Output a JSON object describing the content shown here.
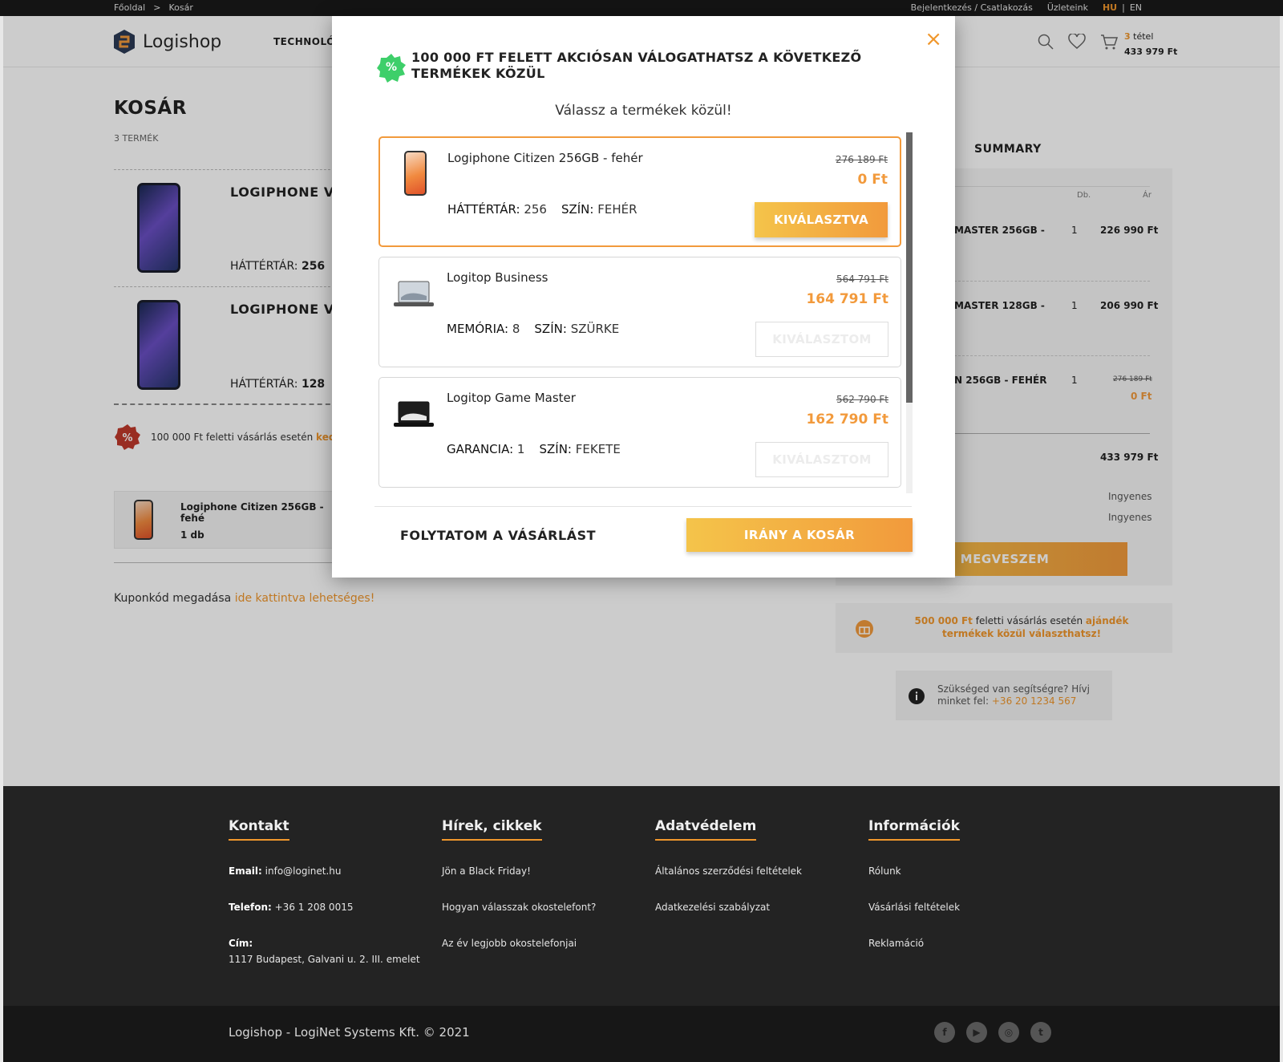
{
  "topbar": {
    "breadcrumb_home": "Főoldal",
    "breadcrumb_sep": ">",
    "breadcrumb_current": "Kosár",
    "login": "Bejelentkezés / Csatlakozás",
    "stores": "Üzleteink",
    "lang_hu": "HU",
    "lang_sep": "|",
    "lang_en": "EN"
  },
  "header": {
    "logo_text": "Logishop",
    "nav_tech": "TECHNOLÓG",
    "cart_count": "3",
    "cart_count_label": "tétel",
    "cart_total": "433 979 Ft"
  },
  "cart": {
    "title": "KOSÁR",
    "count": "3 TERMÉK",
    "items": [
      {
        "name": "LOGIPHONE VL",
        "attr_label": "HÁTTÉRTÁR:",
        "attr_value": "256"
      },
      {
        "name": "LOGIPHONE VL",
        "attr_label": "HÁTTÉRTÁR:",
        "attr_value": "128"
      }
    ],
    "promo_text": "100 000 Ft feletti vásárlás esetén",
    "promo_highlight": "kedv",
    "gift_item_name": "Logiphone Citizen 256GB - fehé",
    "gift_item_qty": "1 db",
    "coupon_text": "Kuponkód megadása",
    "coupon_link": "ide kattintva lehetséges!"
  },
  "summary": {
    "title": "SUMMARY",
    "col_qty": "Db.",
    "col_price": "Ár",
    "rows": [
      {
        "name": "MASTER 256GB -",
        "qty": "1",
        "price": "226 990 Ft"
      },
      {
        "name": "MASTER 128GB -",
        "qty": "1",
        "price": "206 990 Ft"
      },
      {
        "name": "N 256GB - FEHÉR",
        "qty": "1",
        "old_price": "276 189 Ft",
        "price": "0 Ft"
      }
    ],
    "total": "433 979 Ft",
    "shipping1": "Ingyenes",
    "shipping2": "Ingyenes",
    "buy_label": "MEGVESZEM",
    "gift_amount": "500 000 Ft",
    "gift_text": "feletti vásárlás esetén",
    "gift_highlight": "ajándék termékek közül választhatsz!",
    "help_text": "Szükséged van segítségre? Hívj minket fel:",
    "help_phone": "+36 20 1234 567"
  },
  "modal": {
    "title": "100 000 FT FELETT AKCIÓSAN VÁLOGATHATSZ A KÖVETKEZŐ TERMÉKEK KÖZÜL",
    "subtitle": "Válassz a termékek közül!",
    "products": [
      {
        "name": "Logiphone Citizen 256GB - fehér",
        "attr1_label": "HÁTTÉRTÁR:",
        "attr1_value": "256",
        "attr2_label": "SZÍN:",
        "attr2_value": "FEHÉR",
        "old_price": "276 189 Ft",
        "price": "0 Ft",
        "button": "KIVÁLASZTVA"
      },
      {
        "name": "Logitop Business",
        "attr1_label": "MEMÓRIA:",
        "attr1_value": "8",
        "attr2_label": "SZÍN:",
        "attr2_value": "SZÜRKE",
        "old_price": "564 791 Ft",
        "price": "164 791 Ft",
        "button": "KIVÁLASZTOM"
      },
      {
        "name": "Logitop Game Master",
        "attr1_label": "GARANCIA:",
        "attr1_value": "1",
        "attr2_label": "SZÍN:",
        "attr2_value": "FEKETE",
        "old_price": "562 790 Ft",
        "price": "162 790 Ft",
        "button": "KIVÁLASZTOM"
      }
    ],
    "continue_label": "FOLYTATOM A VÁSÁRLÁST",
    "go_cart_label": "IRÁNY A KOSÁR",
    "badge_symbol": "%",
    "close_symbol": "×"
  },
  "footer": {
    "cols": [
      {
        "title": "Kontakt",
        "lines": []
      },
      {
        "title": "Hírek, cikkek",
        "lines": [
          "Jön a Black Friday!",
          "Hogyan válasszak okostelefont?",
          "Az év legjobb okostelefonjai"
        ]
      },
      {
        "title": "Adatvédelem",
        "lines": [
          "Általános szerződési feltételek",
          "Adatkezelési szabályzat"
        ]
      },
      {
        "title": "Információk",
        "lines": [
          "Rólunk",
          "Vásárlási feltételek",
          "Reklamáció"
        ]
      }
    ],
    "email_label": "Email:",
    "email": "info@loginet.hu",
    "phone_label": "Telefon:",
    "phone": "+36 1 208 0015",
    "address_label": "Cím:",
    "address": "1117 Budapest, Galvani u. 2. III. emelet",
    "copyright": "Logishop - LogiNet Systems Kft. © 2021",
    "social": [
      "f",
      "▶",
      "◎",
      "t"
    ]
  },
  "colors": {
    "accent": "#f29a3c",
    "accent_light": "#f4c44a",
    "footer_bg": "#232323",
    "badge_green": "#3ecf6a"
  }
}
